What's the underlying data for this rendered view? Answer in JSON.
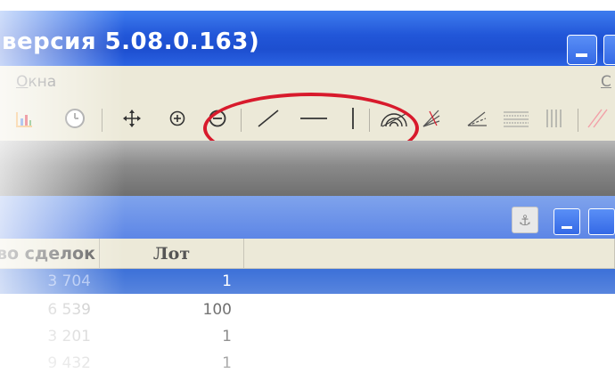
{
  "window": {
    "title": "версия 5.08.0.163)",
    "minimize_icon": "minimize-icon",
    "maximize_icon": "maximize-icon"
  },
  "menu": {
    "windows_label_first": "О",
    "windows_label_rest": "кна",
    "right_label": "С"
  },
  "toolbar": {
    "icons": [
      "bar-chart-icon",
      "clock-icon",
      "move-icon",
      "zoom-in-icon",
      "zoom-out-icon",
      "trend-line-icon",
      "horizontal-line-icon",
      "vertical-line-icon",
      "fibonacci-arcs-icon",
      "fibonacci-fan-icon",
      "angle-icon",
      "horizontal-lines-icon",
      "vertical-lines-icon",
      "diagonal-lines-icon"
    ],
    "highlight_color": "#d81a2c"
  },
  "panel": {
    "anchor_icon": "anchor-icon",
    "anchor_glyph": "⚓"
  },
  "table": {
    "columns": [
      "во сделок",
      "Лот",
      ""
    ],
    "rows": [
      {
        "count": "3 704",
        "lot": "1",
        "selected": true
      },
      {
        "count": "6 539",
        "lot": "100",
        "selected": false
      },
      {
        "count": "3 201",
        "lot": "1",
        "selected": false
      },
      {
        "count": "9 432",
        "lot": "1",
        "selected": false
      }
    ]
  },
  "colors": {
    "titlebar": "#2156d8",
    "selection": "#3a6fd8",
    "toolbar_bg": "#ece9d8"
  }
}
